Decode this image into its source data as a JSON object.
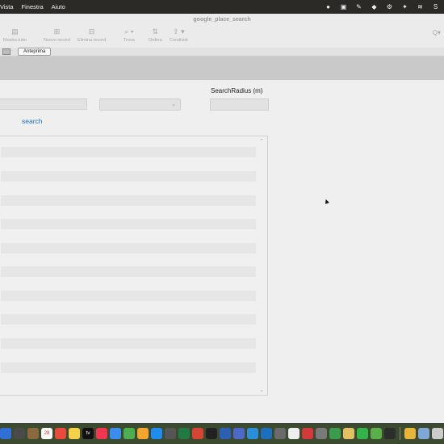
{
  "menubar": {
    "items": [
      "Vista",
      "Finestra",
      "Aiuto"
    ],
    "status_icons": [
      "record-icon",
      "calendar-icon",
      "pen-icon",
      "shield-icon",
      "gear-icon",
      "dropbox-icon",
      "wifi-icon",
      "skype-icon"
    ]
  },
  "window": {
    "title": "google_place_search"
  },
  "toolbar": {
    "show_all": "Mostra tutto",
    "new_record": "Nuovo record",
    "delete_record": "Elimina record",
    "find": "Trova",
    "sort": "Ordina",
    "share": "Condividi"
  },
  "layoutbar": {
    "preview_label": "Anteprima"
  },
  "form": {
    "radius_label": "SearchRadius (m)",
    "search_link": "search"
  },
  "dock": {
    "apps": [
      {
        "name": "dock-app-1",
        "color": "#2f6fd6"
      },
      {
        "name": "dock-app-2",
        "color": "#4a4a4a"
      },
      {
        "name": "dock-app-3",
        "color": "#8a6a3c"
      },
      {
        "name": "dock-app-calendar",
        "color": "#ffffff",
        "label": "28"
      },
      {
        "name": "dock-app-5",
        "color": "#e84b3c"
      },
      {
        "name": "dock-app-6",
        "color": "#f5d148"
      },
      {
        "name": "dock-app-tv",
        "color": "#111111",
        "label": "tv"
      },
      {
        "name": "dock-app-music",
        "color": "#f2364f"
      },
      {
        "name": "dock-app-9",
        "color": "#3a8ef0"
      },
      {
        "name": "dock-app-10",
        "color": "#4caf50"
      },
      {
        "name": "dock-app-11",
        "color": "#f3a52f"
      },
      {
        "name": "dock-app-appstore",
        "color": "#1e8cf0"
      },
      {
        "name": "dock-app-13",
        "color": "#555555"
      },
      {
        "name": "dock-app-excel",
        "color": "#1f7a44"
      },
      {
        "name": "dock-app-15",
        "color": "#d64532"
      },
      {
        "name": "dock-app-16",
        "color": "#222222"
      },
      {
        "name": "dock-app-word",
        "color": "#2b5fb3"
      },
      {
        "name": "dock-app-18",
        "color": "#4c68c9"
      },
      {
        "name": "dock-app-19",
        "color": "#2a8fd8"
      },
      {
        "name": "dock-app-20",
        "color": "#1a6fbf"
      },
      {
        "name": "dock-app-21",
        "color": "#6a6a6a"
      },
      {
        "name": "dock-app-22",
        "color": "#eeeeee"
      },
      {
        "name": "dock-app-23",
        "color": "#d33b3b"
      },
      {
        "name": "dock-app-24",
        "color": "#7a7a7a"
      },
      {
        "name": "dock-app-25",
        "color": "#3b9c4e"
      },
      {
        "name": "dock-app-26",
        "color": "#e0c060"
      },
      {
        "name": "dock-app-whatsapp",
        "color": "#33b44a"
      },
      {
        "name": "dock-app-28",
        "color": "#58b048"
      },
      {
        "name": "dock-app-29",
        "color": "#2d2d2d"
      },
      {
        "name": "dock-app-chrome",
        "color": "#e8b43a"
      },
      {
        "name": "dock-app-31",
        "color": "#7fa7d8"
      },
      {
        "name": "dock-app-32",
        "color": "#cccccc"
      }
    ]
  }
}
